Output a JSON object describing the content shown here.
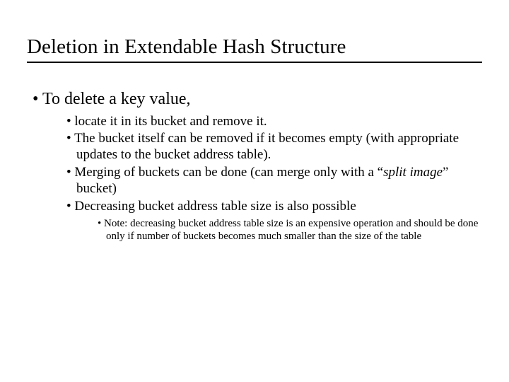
{
  "title": "Deletion in Extendable Hash Structure",
  "lvl1_item": "To delete a key value,",
  "lvl2": {
    "b1": "locate it in its bucket and remove it.",
    "b2": "The bucket itself can be removed if it becomes empty (with appropriate updates to the bucket address table).",
    "b3_pre": "Merging of buckets can be done (can merge only with a “",
    "b3_em": "split image",
    "b3_post": "” bucket)",
    "b4": "Decreasing bucket address table size is also possible"
  },
  "lvl3": {
    "n1": "Note: decreasing bucket address table size is an expensive operation and should be done only if number of buckets becomes much smaller than the size of the table"
  }
}
